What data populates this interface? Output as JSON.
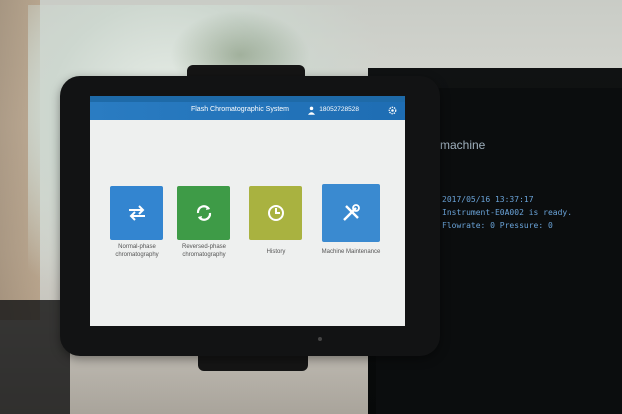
{
  "monitor": {
    "heading": "machine",
    "log_lines": [
      "2017/05/16 13:37:17",
      "Instrument-E0A002 is ready.",
      "",
      "Flowrate: 0  Pressure: 0"
    ]
  },
  "tablet": {
    "app_title": "Flash Chromatographic System",
    "phone": "18052728528",
    "tiles": [
      {
        "label": "Normal-phase chromatography",
        "icon": "swap-arrows-icon",
        "color": "#3385d0"
      },
      {
        "label": "Reversed-phase chromatography",
        "icon": "refresh-icon",
        "color": "#3e9b47"
      },
      {
        "label": "History",
        "icon": "clock-icon",
        "color": "#a9b240"
      },
      {
        "label": "Machine Maintenance",
        "icon": "tools-icon",
        "color": "#3a8ad0"
      }
    ]
  }
}
